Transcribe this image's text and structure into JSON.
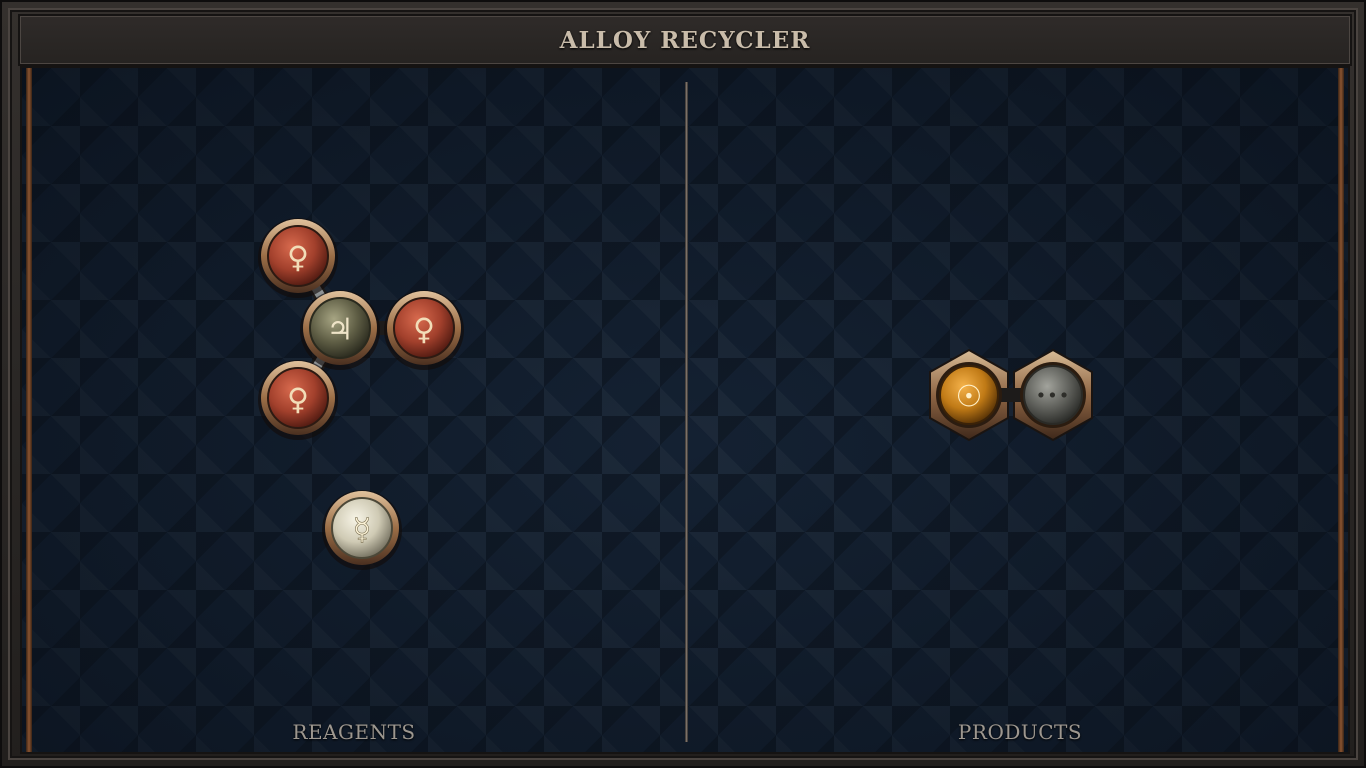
{
  "window": {
    "title": "ALLOY RECYCLER"
  },
  "zones": {
    "reagents": {
      "label": "REAGENTS"
    },
    "products": {
      "label": "PRODUCTS"
    }
  },
  "reagents": {
    "molecule_1": {
      "atoms": [
        {
          "element": "copper",
          "symbol": "♀"
        },
        {
          "element": "tin",
          "symbol": "♃"
        },
        {
          "element": "copper",
          "symbol": "♀"
        },
        {
          "element": "copper",
          "symbol": "♀"
        }
      ]
    },
    "molecule_2": {
      "atoms": [
        {
          "element": "quicksilver",
          "symbol": "☿"
        }
      ]
    }
  },
  "products": {
    "molecule_1": {
      "atoms": [
        {
          "element": "gold",
          "symbol": "☉"
        },
        {
          "element": "wildcard",
          "symbol": "•••"
        }
      ]
    }
  },
  "colors": {
    "copper": "#a2402c",
    "tin": "#5f5e45",
    "quicksilver": "#cfcab4",
    "gold": "#c07a16",
    "wildcard": "#5f605b",
    "rim": "#b48a63",
    "glyph_light": "#f2ddb8",
    "glyph_dark": "#3c3a30"
  }
}
